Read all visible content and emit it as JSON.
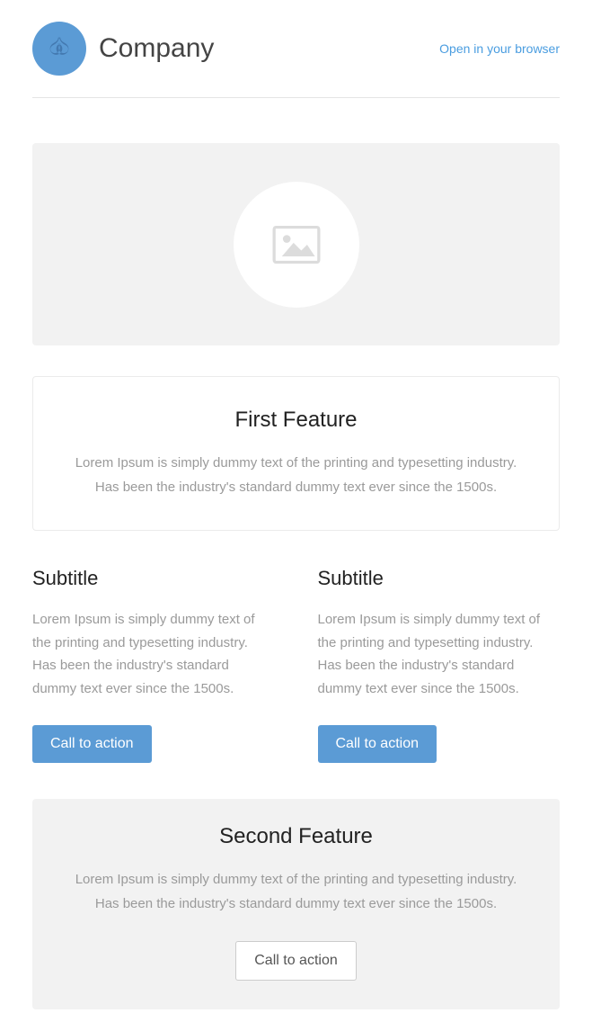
{
  "header": {
    "company_name": "Company",
    "browser_link": "Open in your browser"
  },
  "feature1": {
    "title": "First Feature",
    "text": "Lorem Ipsum is simply dummy text of the printing and typesetting industry. Has been the industry's standard dummy text ever since the 1500s."
  },
  "columns": [
    {
      "subtitle": "Subtitle",
      "text": "Lorem Ipsum is simply dummy text of the printing and typesetting industry. Has been the industry's standard dummy text ever since the 1500s.",
      "cta": "Call to action"
    },
    {
      "subtitle": "Subtitle",
      "text": "Lorem Ipsum is simply dummy text of the printing and typesetting industry. Has been the industry's standard dummy text ever since the 1500s.",
      "cta": "Call to action"
    }
  ],
  "feature2": {
    "title": "Second Feature",
    "text": "Lorem Ipsum is simply dummy text of the printing and typesetting industry. Has been the industry's standard dummy text ever since the 1500s.",
    "cta": "Call to action"
  }
}
